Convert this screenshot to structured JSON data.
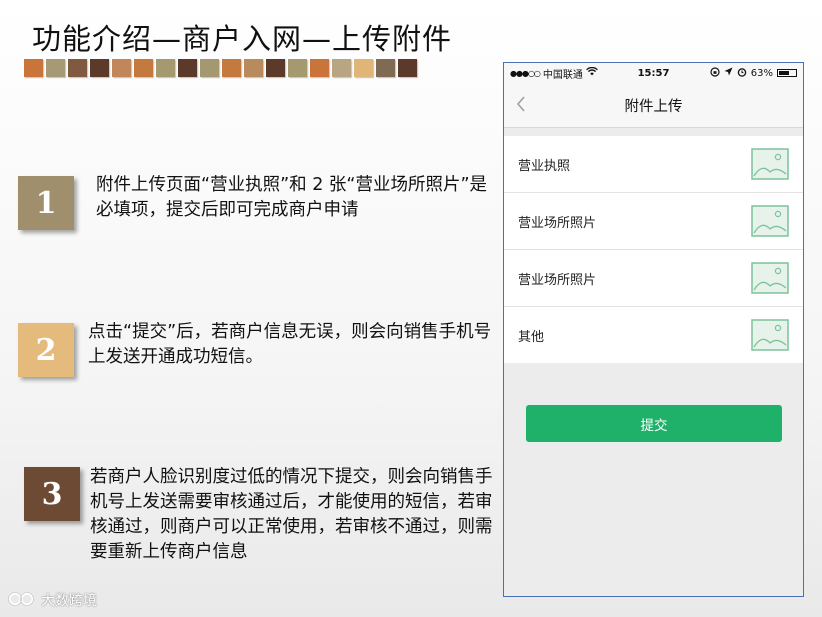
{
  "slide": {
    "title": "功能介绍—商户入网—上传附件",
    "strip_colors": [
      "#c8743a",
      "#a69a74",
      "#7f5a3e",
      "#5b3a2a",
      "#c1875a",
      "#c47a3e",
      "#a59a6f",
      "#5b3a2a",
      "#a49870",
      "#c47a3e",
      "#b98a5c",
      "#5b3a2a",
      "#a59a6f",
      "#c8743a",
      "#b9a582",
      "#e0b678",
      "#7f6a52",
      "#5b3a2a"
    ]
  },
  "steps": [
    {
      "num": "1",
      "color": "#a08f6d",
      "text": "附件上传页面“营业执照”和 2 张“营业场所照片”是必填项，提交后即可完成商户申请"
    },
    {
      "num": "2",
      "color": "#e4ba7d",
      "text": "点击“提交”后，若商户信息无误，则会向销售手机号上发送开通成功短信。"
    },
    {
      "num": "3",
      "color": "#6d4a33",
      "text": "若商户人脸识别度过低的情况下提交，则会向销售手机号上发送需要审核通过后，才能使用的短信，若审核通过，则商户可以正常使用，若审核不通过，则需要重新上传商户信息"
    }
  ],
  "phone": {
    "statusbar": {
      "signal": "●●●○○",
      "carrier": "中国联通",
      "time": "15:57",
      "battery": "63%",
      "battery_level": 0.63
    },
    "nav": {
      "title": "附件上传",
      "back_icon": "chevron-left-icon"
    },
    "rows": [
      {
        "label": "营业执照",
        "icon": "image-placeholder-icon"
      },
      {
        "label": "营业场所照片",
        "icon": "image-placeholder-icon"
      },
      {
        "label": "营业场所照片",
        "icon": "image-placeholder-icon"
      },
      {
        "label": "其他",
        "icon": "image-placeholder-icon"
      }
    ],
    "submit_label": "提交",
    "accent": "#1fb16a"
  },
  "watermark": {
    "text": "大数跨境"
  }
}
